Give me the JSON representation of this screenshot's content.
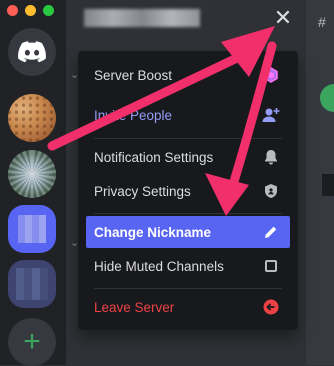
{
  "window": {
    "close_icon": "close-icon"
  },
  "servers": [
    {
      "name": "discord-home",
      "icon": "discord-logo-icon"
    },
    {
      "name": "server-cookie"
    },
    {
      "name": "server-tree"
    },
    {
      "name": "server-blurred-blue"
    },
    {
      "name": "server-blurred-dark"
    },
    {
      "name": "add-server",
      "icon": "plus-icon"
    }
  ],
  "menu": {
    "items": [
      {
        "label": "Server Boost",
        "icon": "boost-gem-icon",
        "style": "normal"
      },
      {
        "label": "Invite People",
        "icon": "add-person-icon",
        "style": "blurple"
      },
      {
        "label": "Notification Settings",
        "icon": "bell-icon",
        "style": "normal"
      },
      {
        "label": "Privacy Settings",
        "icon": "shield-icon",
        "style": "normal"
      },
      {
        "label": "Change Nickname",
        "icon": "pencil-icon",
        "style": "active"
      },
      {
        "label": "Hide Muted Channels",
        "icon": "checkbox-icon",
        "style": "normal",
        "checked": false
      },
      {
        "label": "Leave Server",
        "icon": "leave-arrow-icon",
        "style": "danger"
      }
    ]
  },
  "colors": {
    "accent": "#5865f2",
    "danger": "#ed4245",
    "annotation_arrow": "#f1306b",
    "boost_pink": "#ff73fa"
  }
}
